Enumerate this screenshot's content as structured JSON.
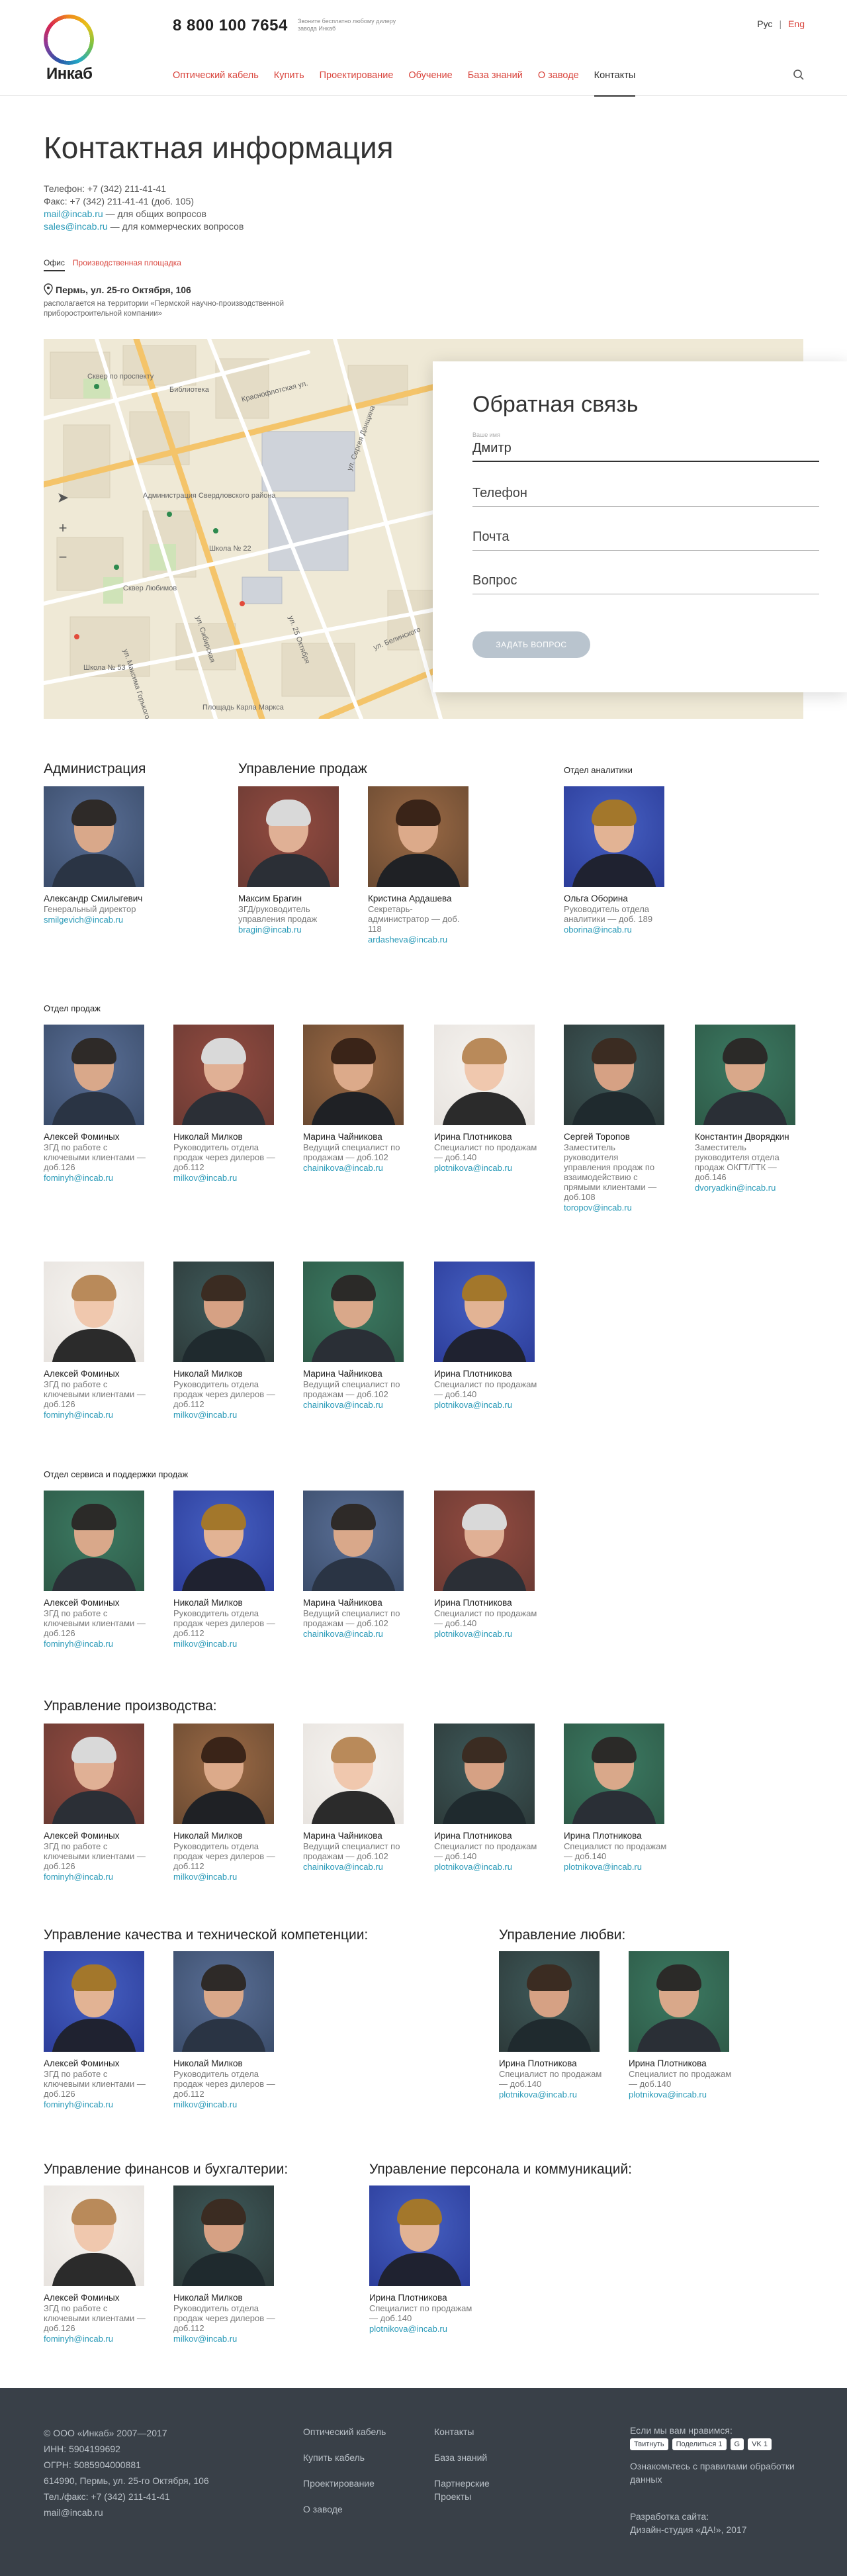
{
  "header": {
    "logo_text": "Инкаб",
    "phone": "8 800 100 7654",
    "phone_note": "Звоните бесплатно любому дилеру завода Инкаб",
    "lang": [
      "Рус",
      "Eng"
    ],
    "nav": [
      "Оптический кабель",
      "Купить",
      "Проектирование",
      "Обучение",
      "База знаний",
      "О заводе",
      "Контакты"
    ],
    "active_nav": "Контакты"
  },
  "page": {
    "title": "Контактная информация",
    "phone": "Телефон: +7 (342) 211-41-41",
    "fax": "Факс: +7 (342) 211-41-41 (доб. 105)",
    "mail_general": "mail@incab.ru",
    "mail_general_note": " — для общих вопросов",
    "mail_sales": "sales@incab.ru",
    "mail_sales_note": " — для коммерческих вопросов",
    "tabs": [
      "Офис",
      "Производственная площадка"
    ],
    "address": "Пермь, ул. 25-го Октября, 106",
    "address_note": "располагается на территории «Пермской научно-производственной приборостроительной компании»"
  },
  "map": {
    "streets": [
      "Краснофлотская ул.",
      "ул. Сергея Данщина",
      "ул. 25 Октября",
      "ул. Белинского",
      "ул. Сибирская",
      "ул. Максима Горького"
    ],
    "places": [
      "Сквер по проспекту",
      "Школа № 22",
      "Администрация Свердловского района",
      "Библиотека",
      "Сквер Любимов",
      "Площадь Карла Маркса",
      "Школа № 53"
    ],
    "zoom_in": "+",
    "zoom_out": "−"
  },
  "feedback": {
    "title": "Обратная связь",
    "name_label": "Ваше имя",
    "name_value": "Дмитр",
    "phone_placeholder": "Телефон",
    "mail_placeholder": "Почта",
    "question_placeholder": "Вопрос",
    "submit": "ЗАДАТЬ ВОПРОС"
  },
  "staff": {
    "admin_title": "Администрация",
    "sales_mgmt_title": "Управление продаж",
    "analytics_title": "Отдел аналитики",
    "sales_dept_title": "Отдел продаж",
    "service_title": "Отдел сервиса и поддержки продаж",
    "production_title": "Управление производства:",
    "quality_title": "Управление качества и технической компетенции:",
    "love_title": "Управление любви:",
    "finance_title": "Управление финансов и бухгалтерии:",
    "hr_title": "Управление персонала и коммуникаций:",
    "people": {
      "admin": [
        {
          "name": "Александр Смилыгевич",
          "role": "Генеральный директор",
          "mail": "smilgevich@incab.ru"
        }
      ],
      "sales_mgmt": [
        {
          "name": "Максим Брагин",
          "role": "ЗГД/руководитель управления продаж",
          "mail": "bragin@incab.ru"
        },
        {
          "name": "Кристина Ардашева",
          "role": "Секретарь-администратор — доб. 118",
          "mail": "ardasheva@incab.ru"
        }
      ],
      "analytics": [
        {
          "name": "Ольга Оборина",
          "role": "Руководитель отдела аналитики — доб. 189",
          "mail": "oborina@incab.ru"
        }
      ],
      "sales_row1": [
        {
          "name": "Алексей Фоминых",
          "role": "ЗГД по работе с ключевыми клиентами — доб.126",
          "mail": "fominyh@incab.ru"
        },
        {
          "name": "Николай Милков",
          "role": "Руководитель отдела продаж через дилеров — доб.112",
          "mail": "milkov@incab.ru"
        },
        {
          "name": "Марина Чайникова",
          "role": "Ведущий специалист по продажам — доб.102",
          "mail": "chainikova@incab.ru"
        },
        {
          "name": "Ирина Плотникова",
          "role": "Специалист по продажам — доб.140",
          "mail": "plotnikova@incab.ru"
        },
        {
          "name": "Сергей Торопов",
          "role": "Заместитель руководителя управления продаж по взаимодействию с прямыми клиентами — доб.108",
          "mail": "toropov@incab.ru"
        },
        {
          "name": "Константин Дворядкин",
          "role": "Заместитель руководителя отдела продаж ОКГТ/ГТК — доб.146",
          "mail": "dvoryadkin@incab.ru"
        }
      ],
      "sales_row2": [
        {
          "name": "Алексей Фоминых",
          "role": "ЗГД по работе с ключевыми клиентами — доб.126",
          "mail": "fominyh@incab.ru"
        },
        {
          "name": "Николай Милков",
          "role": "Руководитель отдела продаж через дилеров — доб.112",
          "mail": "milkov@incab.ru"
        },
        {
          "name": "Марина Чайникова",
          "role": "Ведущий специалист по продажам — доб.102",
          "mail": "chainikova@incab.ru"
        },
        {
          "name": "Ирина Плотникова",
          "role": "Специалист по продажам — доб.140",
          "mail": "plotnikova@incab.ru"
        }
      ],
      "service": [
        {
          "name": "Алексей Фоминых",
          "role": "ЗГД по работе с ключевыми клиентами — доб.126",
          "mail": "fominyh@incab.ru"
        },
        {
          "name": "Николай Милков",
          "role": "Руководитель отдела продаж через дилеров — доб.112",
          "mail": "milkov@incab.ru"
        },
        {
          "name": "Марина Чайникова",
          "role": "Ведущий специалист по продажам — доб.102",
          "mail": "chainikova@incab.ru"
        },
        {
          "name": "Ирина Плотникова",
          "role": "Специалист по продажам — доб.140",
          "mail": "plotnikova@incab.ru"
        }
      ],
      "production": [
        {
          "name": "Алексей Фоминых",
          "role": "ЗГД по работе с ключевыми клиентами — доб.126",
          "mail": "fominyh@incab.ru"
        },
        {
          "name": "Николай Милков",
          "role": "Руководитель отдела продаж через дилеров — доб.112",
          "mail": "milkov@incab.ru"
        },
        {
          "name": "Марина Чайникова",
          "role": "Ведущий специалист по продажам — доб.102",
          "mail": "chainikova@incab.ru"
        },
        {
          "name": "Ирина Плотникова",
          "role": "Специалист по продажам — доб.140",
          "mail": "plotnikova@incab.ru"
        },
        {
          "name": "Ирина Плотникова",
          "role": "Специалист по продажам — доб.140",
          "mail": "plotnikova@incab.ru"
        }
      ],
      "quality": [
        {
          "name": "Алексей Фоминых",
          "role": "ЗГД по работе с ключевыми клиентами — доб.126",
          "mail": "fominyh@incab.ru"
        },
        {
          "name": "Николай Милков",
          "role": "Руководитель отдела продаж через дилеров — доб.112",
          "mail": "milkov@incab.ru"
        }
      ],
      "love": [
        {
          "name": "Ирина Плотникова",
          "role": "Специалист по продажам — доб.140",
          "mail": "plotnikova@incab.ru"
        },
        {
          "name": "Ирина Плотникова",
          "role": "Специалист по продажам — доб.140",
          "mail": "plotnikova@incab.ru"
        }
      ],
      "finance": [
        {
          "name": "Алексей Фоминых",
          "role": "ЗГД по работе с ключевыми клиентами — доб.126",
          "mail": "fominyh@incab.ru"
        },
        {
          "name": "Николай Милков",
          "role": "Руководитель отдела продаж через дилеров — доб.112",
          "mail": "milkov@incab.ru"
        }
      ],
      "hr": [
        {
          "name": "Ирина Плотникова",
          "role": "Специалист по продажам — доб.140",
          "mail": "plotnikova@incab.ru"
        }
      ]
    }
  },
  "footer": {
    "copyright": "© ООО «Инкаб» 2007—2017",
    "inn": "ИНН: 5904199692",
    "ogrn": "ОГРН: 5085904000881",
    "address": "614990, Пермь, ул. 25-го Октября, 106",
    "phone": "Тел./факс: +7 (342) 211-41-41",
    "mail": "mail@incab.ru",
    "col1": [
      "Оптический кабель",
      "Купить кабель",
      "Проектирование",
      "О заводе"
    ],
    "col2": [
      "Контакты",
      "База знаний",
      "Партнерские Проекты"
    ],
    "like": "Если мы вам нравимся:",
    "share": [
      "Твитнуть",
      "Поделиться 1",
      "G",
      "VK 1"
    ],
    "policy": "Ознакомьтесь с правилами обработки данных",
    "dev1": "Разработка сайта:",
    "dev2": "Дизайн-студия «ДА!», 2017"
  }
}
